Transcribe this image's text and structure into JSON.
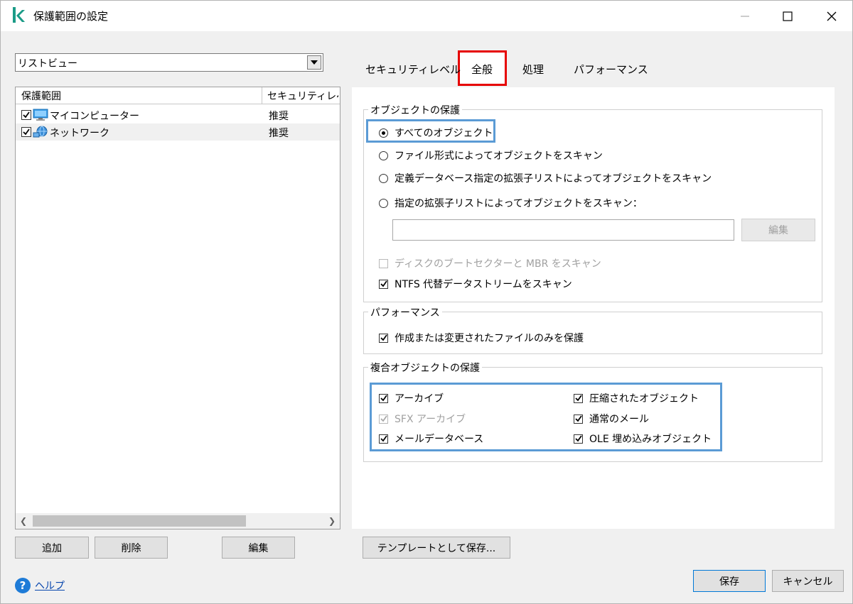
{
  "window": {
    "title": "保護範囲の設定",
    "accent_color": "#1b9b87"
  },
  "left": {
    "view_select_value": "リストビュー",
    "columns": [
      "保護範囲",
      "セキュリティレベル"
    ],
    "rows": [
      {
        "label": "マイコンピューター",
        "level": "推奨",
        "checked": true,
        "icon": "computer-icon"
      },
      {
        "label": "ネットワーク",
        "level": "推奨",
        "checked": true,
        "icon": "network-icon"
      }
    ],
    "buttons": {
      "add": "追加",
      "delete": "削除",
      "edit": "編集"
    }
  },
  "tabs": [
    {
      "label": "セキュリティレベル",
      "active": false
    },
    {
      "label": "全般",
      "active": true
    },
    {
      "label": "処理",
      "active": false
    },
    {
      "label": "パフォーマンス",
      "active": false
    }
  ],
  "object_protection": {
    "title": "オブジェクトの保護",
    "radios": [
      {
        "label": "すべてのオブジェクト",
        "selected": true
      },
      {
        "label": "ファイル形式によってオブジェクトをスキャン",
        "selected": false
      },
      {
        "label": "定義データベース指定の拡張子リストによってオブジェクトをスキャン",
        "selected": false
      },
      {
        "label": "指定の拡張子リストによってオブジェクトをスキャン：",
        "selected": false
      }
    ],
    "extension_input_value": "",
    "edit_button": "編集",
    "boot_sector": {
      "label": "ディスクのブートセクターと MBR をスキャン",
      "checked": false,
      "disabled": true
    },
    "ntfs": {
      "label": "NTFS 代替データストリームをスキャン",
      "checked": true
    }
  },
  "performance": {
    "title": "パフォーマンス",
    "only_new": {
      "label": "作成または変更されたファイルのみを保護",
      "checked": true
    }
  },
  "compound": {
    "title": "複合オブジェクトの保護",
    "items": [
      {
        "label": "アーカイブ",
        "checked": true,
        "disabled": false
      },
      {
        "label": "SFX アーカイブ",
        "checked": true,
        "disabled": true
      },
      {
        "label": "メールデータベース",
        "checked": true,
        "disabled": false
      },
      {
        "label": "圧縮されたオブジェクト",
        "checked": true,
        "disabled": false
      },
      {
        "label": "通常のメール",
        "checked": true,
        "disabled": false
      },
      {
        "label": "OLE 埋め込みオブジェクト",
        "checked": true,
        "disabled": false
      }
    ]
  },
  "bottom": {
    "save_as_template": "テンプレートとして保存...",
    "help": "ヘルプ",
    "save": "保存",
    "cancel": "キャンセル"
  }
}
